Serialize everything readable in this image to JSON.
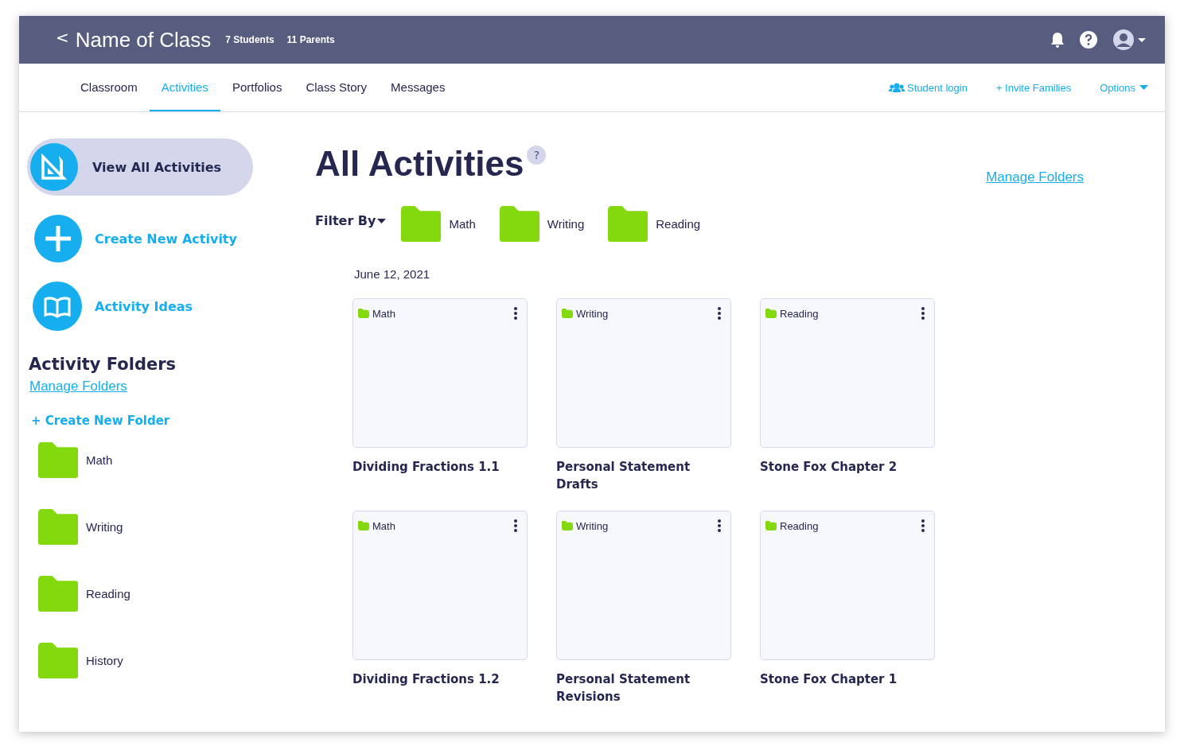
{
  "header": {
    "back": "<",
    "title": "Name of Class",
    "counts": [
      "7 Students",
      "11 Parents"
    ]
  },
  "tabs": [
    {
      "label": "Classroom",
      "selected": false
    },
    {
      "label": "Activities",
      "selected": true
    },
    {
      "label": "Portfolios",
      "selected": false
    },
    {
      "label": "Class Story",
      "selected": false
    },
    {
      "label": "Messages",
      "selected": false
    }
  ],
  "nav_actions": [
    {
      "kind": "student",
      "label": "Student login"
    },
    {
      "kind": "invite",
      "label": "+ Invite Families"
    },
    {
      "kind": "options",
      "label": "Options"
    }
  ],
  "sidebar": {
    "items": [
      {
        "kind": "view",
        "label": "View All Activities",
        "selected": true
      },
      {
        "kind": "create",
        "label": "Create New Activity",
        "selected": false
      },
      {
        "kind": "ideas",
        "label": "Activity Ideas",
        "selected": false
      }
    ],
    "folders_heading": "Activity Folders",
    "manage_link": "Manage Folders",
    "create_folder": "+ Create New Folder",
    "folders": [
      "Math",
      "Writing",
      "Reading",
      "History"
    ]
  },
  "main": {
    "title": "All Activities",
    "help": "?",
    "manage_link": "Manage Folders",
    "filter_label": "Filter By",
    "filters": [
      "Math",
      "Writing",
      "Reading"
    ],
    "date": "June 12, 2021",
    "activities": [
      {
        "folder": "Math",
        "title": "Dividing Fractions 1.1"
      },
      {
        "folder": "Writing",
        "title": "Personal Statement Drafts"
      },
      {
        "folder": "Reading",
        "title": "Stone Fox Chapter 2"
      },
      {
        "folder": "Math",
        "title": "Dividing Fractions 1.2"
      },
      {
        "folder": "Writing",
        "title": "Personal Statement Revisions"
      },
      {
        "folder": "Reading",
        "title": "Stone Fox Chapter 1"
      }
    ]
  }
}
